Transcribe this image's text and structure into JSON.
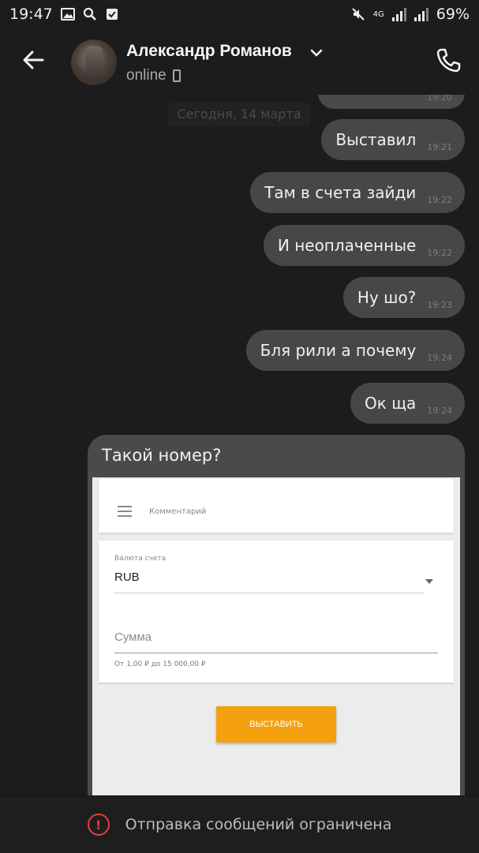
{
  "status_bar": {
    "time": "19:47",
    "network": "4G",
    "battery": "69%"
  },
  "header": {
    "contact_name": "Александр Романов",
    "presence": "online"
  },
  "chat": {
    "date_separator": "Сегодня, 14 марта",
    "top_bubble_time": "19:20",
    "messages": [
      {
        "text": "Выставил",
        "time": "19:21"
      },
      {
        "text": "Там в счета зайди",
        "time": "19:22"
      },
      {
        "text": "И неоплаченные",
        "time": "19:22"
      },
      {
        "text": "Ну шо?",
        "time": "19:23"
      },
      {
        "text": "Бля рили а почему",
        "time": "19:24"
      },
      {
        "text": "Ок ща",
        "time": "19:24"
      }
    ],
    "card": {
      "caption": "Такой номер?",
      "screenshot": {
        "comment_label": "Комментарий",
        "currency_label": "Валюта счета",
        "currency_value": "RUB",
        "amount_label": "Сумма",
        "amount_range": "От 1,00 ₽ до 15 000,00 ₽",
        "issue_button": "ВЫСТАВИТЬ"
      }
    }
  },
  "footer": {
    "restriction_text": "Отправка сообщений ограничена"
  },
  "colors": {
    "background": "#1c1c1c",
    "bubble": "#474747",
    "accent_orange": "#f5a00e",
    "warning_red": "#e0403e"
  },
  "icons": [
    "gallery-icon",
    "search-icon",
    "checkbox-icon",
    "mute-icon",
    "signal-icon",
    "back-arrow-icon",
    "chevron-down-icon",
    "phone-icon",
    "menu-icon",
    "warning-icon"
  ]
}
